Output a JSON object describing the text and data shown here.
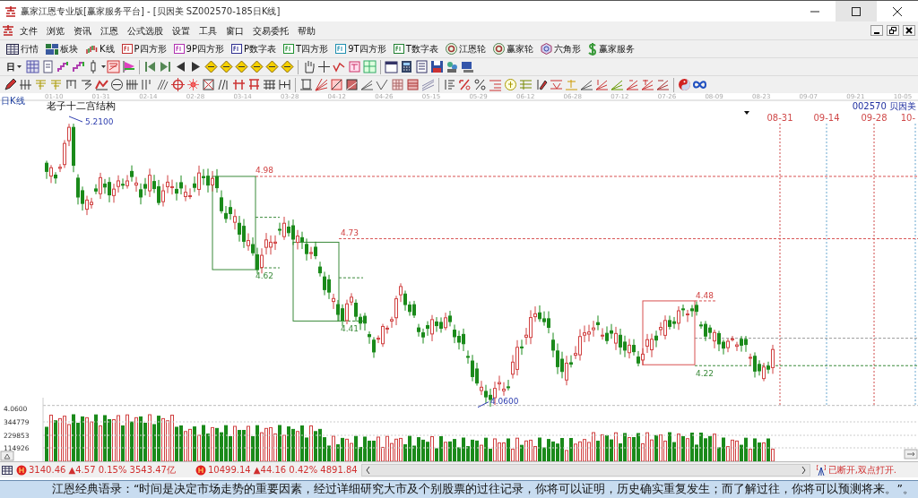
{
  "window": {
    "title": "赢家江恩专业版[赢家服务平台] - [贝因美  SZ002570-185日K线]"
  },
  "menu": [
    "文件",
    "浏览",
    "资讯",
    "江恩",
    "公式选股",
    "设置",
    "工具",
    "窗口",
    "交易委托",
    "帮助"
  ],
  "toolbar": [
    {
      "label": "行情",
      "kind": "grid"
    },
    {
      "label": "板块",
      "kind": "blocks"
    },
    {
      "label": "K线",
      "kind": "candles"
    },
    {
      "label": "P四方形",
      "kind": "tag"
    },
    {
      "label": "9P四方形",
      "kind": "tag"
    },
    {
      "label": "P数字表",
      "kind": "tag"
    },
    {
      "label": "T四方形",
      "kind": "tag"
    },
    {
      "label": "9T四方形",
      "kind": "tag"
    },
    {
      "label": "T数字表",
      "kind": "tag"
    },
    {
      "label": "江恩轮",
      "kind": "wheel"
    },
    {
      "label": "赢家轮",
      "kind": "wheel"
    },
    {
      "label": "六角形",
      "kind": "hexagon"
    },
    {
      "label": "赢家服务",
      "kind": "dollar"
    }
  ],
  "period_button": "日",
  "chart": {
    "period": "日K线",
    "dates": [
      "01-10",
      "01-31",
      "02-14",
      "02-28",
      "03-14",
      "03-28",
      "04-12",
      "04-26",
      "05-15",
      "05-29",
      "06-12",
      "06-28",
      "07-12",
      "07-26",
      "08-09",
      "08-23",
      "09-07",
      "09-21",
      "10-05"
    ],
    "title": "老子十二宫结构",
    "stock_code": "002570",
    "stock_name": "贝因美",
    "future_dates": [
      {
        "text": "08-31",
        "color": "#d04a4a"
      },
      {
        "text": "09-14",
        "color": "#d04a4a"
      },
      {
        "text": "09-28",
        "color": "#d04a4a"
      },
      {
        "text": "10-",
        "color": "#d04a4a"
      }
    ],
    "annotations": [
      {
        "text": "5.2100",
        "kind": "extreme"
      },
      {
        "text": "4.98",
        "kind": "resistance"
      },
      {
        "text": "4.62",
        "kind": "support"
      },
      {
        "text": "4.73",
        "kind": "resistance"
      },
      {
        "text": "4.41",
        "kind": "support"
      },
      {
        "text": "4.48",
        "kind": "resistance"
      },
      {
        "text": "4.22",
        "kind": "support"
      },
      {
        "text": "4.0600",
        "kind": "extreme"
      }
    ],
    "volume_labels": [
      "4.0600",
      "344779",
      "229853",
      "114926"
    ]
  },
  "status": {
    "quotes": [
      "3140.46 ▲4.57 0.15% 3543.47亿",
      "10499.14 ▲44.16 0.42% 4891.84"
    ],
    "connection": "已断开,双点打开."
  },
  "quote_bar": "江恩经典语录：“时间是决定市场走势的重要因素，经过详细研究大市及个别股票的过往记录，你将可以证明，历史确实重复发生；而了解过往，你将可以预测将来。”。"
}
